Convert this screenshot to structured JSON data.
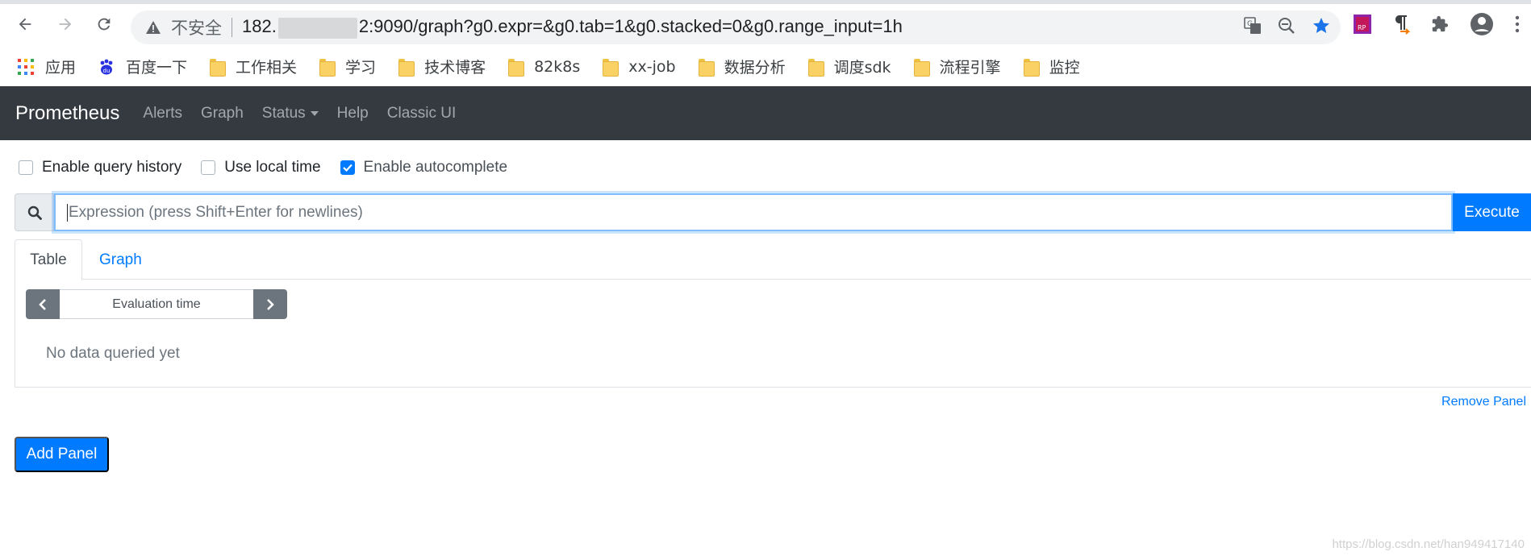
{
  "browser": {
    "insecure_label": "不安全",
    "url_prefix": "182.",
    "url_suffix": "2:9090/graph?g0.expr=&g0.tab=1&g0.stacked=0&g0.range_input=1h",
    "bookmarks": [
      {
        "label": "应用",
        "icon": "apps-grid-icon"
      },
      {
        "label": "百度一下",
        "icon": "baidu-paw-icon"
      },
      {
        "label": "工作相关",
        "icon": "folder-icon"
      },
      {
        "label": "学习",
        "icon": "folder-icon"
      },
      {
        "label": "技术博客",
        "icon": "folder-icon"
      },
      {
        "label": "82k8s",
        "icon": "folder-icon"
      },
      {
        "label": "xx-job",
        "icon": "folder-icon"
      },
      {
        "label": "数据分析",
        "icon": "folder-icon"
      },
      {
        "label": "调度sdk",
        "icon": "folder-icon"
      },
      {
        "label": "流程引擎",
        "icon": "folder-icon"
      },
      {
        "label": "监控",
        "icon": "folder-icon"
      }
    ]
  },
  "nav": {
    "brand": "Prometheus",
    "links": [
      "Alerts",
      "Graph",
      "Status",
      "Help",
      "Classic UI"
    ]
  },
  "options": {
    "query_history": {
      "label": "Enable query history",
      "checked": false
    },
    "local_time": {
      "label": "Use local time",
      "checked": false
    },
    "autocomplete": {
      "label": "Enable autocomplete",
      "checked": true
    }
  },
  "expression": {
    "placeholder": "Expression (press Shift+Enter for newlines)",
    "value": "",
    "execute_label": "Execute"
  },
  "panel": {
    "tabs": [
      "Table",
      "Graph"
    ],
    "active_tab": "Table",
    "eval_time_placeholder": "Evaluation time",
    "empty_message": "No data queried yet",
    "remove_label": "Remove Panel"
  },
  "add_panel_label": "Add Panel",
  "watermark": "https://blog.csdn.net/han949417140",
  "colors": {
    "navbar": "#343a40",
    "primary": "#007bff",
    "secondary": "#6c757d"
  }
}
